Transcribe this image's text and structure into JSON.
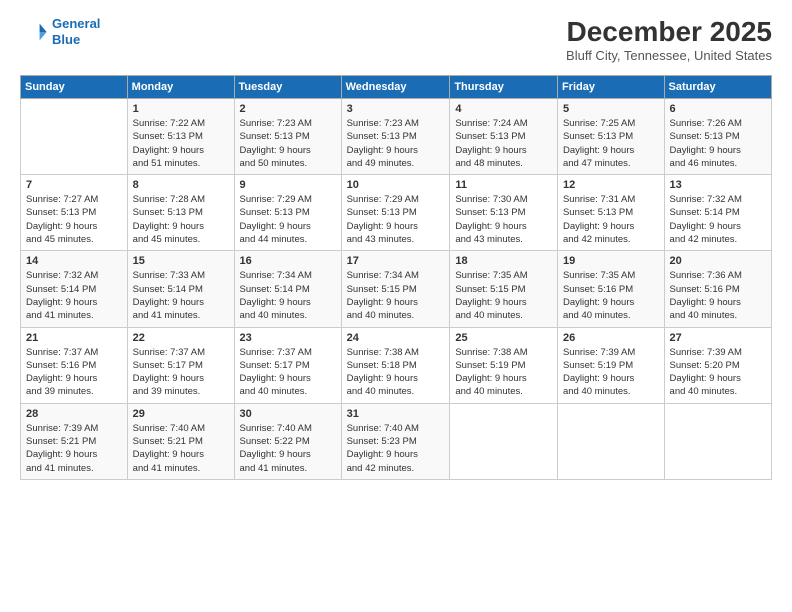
{
  "logo": {
    "line1": "General",
    "line2": "Blue"
  },
  "title": "December 2025",
  "location": "Bluff City, Tennessee, United States",
  "weekdays": [
    "Sunday",
    "Monday",
    "Tuesday",
    "Wednesday",
    "Thursday",
    "Friday",
    "Saturday"
  ],
  "weeks": [
    [
      {
        "day": "",
        "info": ""
      },
      {
        "day": "1",
        "info": "Sunrise: 7:22 AM\nSunset: 5:13 PM\nDaylight: 9 hours\nand 51 minutes."
      },
      {
        "day": "2",
        "info": "Sunrise: 7:23 AM\nSunset: 5:13 PM\nDaylight: 9 hours\nand 50 minutes."
      },
      {
        "day": "3",
        "info": "Sunrise: 7:23 AM\nSunset: 5:13 PM\nDaylight: 9 hours\nand 49 minutes."
      },
      {
        "day": "4",
        "info": "Sunrise: 7:24 AM\nSunset: 5:13 PM\nDaylight: 9 hours\nand 48 minutes."
      },
      {
        "day": "5",
        "info": "Sunrise: 7:25 AM\nSunset: 5:13 PM\nDaylight: 9 hours\nand 47 minutes."
      },
      {
        "day": "6",
        "info": "Sunrise: 7:26 AM\nSunset: 5:13 PM\nDaylight: 9 hours\nand 46 minutes."
      }
    ],
    [
      {
        "day": "7",
        "info": "Sunrise: 7:27 AM\nSunset: 5:13 PM\nDaylight: 9 hours\nand 45 minutes."
      },
      {
        "day": "8",
        "info": "Sunrise: 7:28 AM\nSunset: 5:13 PM\nDaylight: 9 hours\nand 45 minutes."
      },
      {
        "day": "9",
        "info": "Sunrise: 7:29 AM\nSunset: 5:13 PM\nDaylight: 9 hours\nand 44 minutes."
      },
      {
        "day": "10",
        "info": "Sunrise: 7:29 AM\nSunset: 5:13 PM\nDaylight: 9 hours\nand 43 minutes."
      },
      {
        "day": "11",
        "info": "Sunrise: 7:30 AM\nSunset: 5:13 PM\nDaylight: 9 hours\nand 43 minutes."
      },
      {
        "day": "12",
        "info": "Sunrise: 7:31 AM\nSunset: 5:13 PM\nDaylight: 9 hours\nand 42 minutes."
      },
      {
        "day": "13",
        "info": "Sunrise: 7:32 AM\nSunset: 5:14 PM\nDaylight: 9 hours\nand 42 minutes."
      }
    ],
    [
      {
        "day": "14",
        "info": "Sunrise: 7:32 AM\nSunset: 5:14 PM\nDaylight: 9 hours\nand 41 minutes."
      },
      {
        "day": "15",
        "info": "Sunrise: 7:33 AM\nSunset: 5:14 PM\nDaylight: 9 hours\nand 41 minutes."
      },
      {
        "day": "16",
        "info": "Sunrise: 7:34 AM\nSunset: 5:14 PM\nDaylight: 9 hours\nand 40 minutes."
      },
      {
        "day": "17",
        "info": "Sunrise: 7:34 AM\nSunset: 5:15 PM\nDaylight: 9 hours\nand 40 minutes."
      },
      {
        "day": "18",
        "info": "Sunrise: 7:35 AM\nSunset: 5:15 PM\nDaylight: 9 hours\nand 40 minutes."
      },
      {
        "day": "19",
        "info": "Sunrise: 7:35 AM\nSunset: 5:16 PM\nDaylight: 9 hours\nand 40 minutes."
      },
      {
        "day": "20",
        "info": "Sunrise: 7:36 AM\nSunset: 5:16 PM\nDaylight: 9 hours\nand 40 minutes."
      }
    ],
    [
      {
        "day": "21",
        "info": "Sunrise: 7:37 AM\nSunset: 5:16 PM\nDaylight: 9 hours\nand 39 minutes."
      },
      {
        "day": "22",
        "info": "Sunrise: 7:37 AM\nSunset: 5:17 PM\nDaylight: 9 hours\nand 39 minutes."
      },
      {
        "day": "23",
        "info": "Sunrise: 7:37 AM\nSunset: 5:17 PM\nDaylight: 9 hours\nand 40 minutes."
      },
      {
        "day": "24",
        "info": "Sunrise: 7:38 AM\nSunset: 5:18 PM\nDaylight: 9 hours\nand 40 minutes."
      },
      {
        "day": "25",
        "info": "Sunrise: 7:38 AM\nSunset: 5:19 PM\nDaylight: 9 hours\nand 40 minutes."
      },
      {
        "day": "26",
        "info": "Sunrise: 7:39 AM\nSunset: 5:19 PM\nDaylight: 9 hours\nand 40 minutes."
      },
      {
        "day": "27",
        "info": "Sunrise: 7:39 AM\nSunset: 5:20 PM\nDaylight: 9 hours\nand 40 minutes."
      }
    ],
    [
      {
        "day": "28",
        "info": "Sunrise: 7:39 AM\nSunset: 5:21 PM\nDaylight: 9 hours\nand 41 minutes."
      },
      {
        "day": "29",
        "info": "Sunrise: 7:40 AM\nSunset: 5:21 PM\nDaylight: 9 hours\nand 41 minutes."
      },
      {
        "day": "30",
        "info": "Sunrise: 7:40 AM\nSunset: 5:22 PM\nDaylight: 9 hours\nand 41 minutes."
      },
      {
        "day": "31",
        "info": "Sunrise: 7:40 AM\nSunset: 5:23 PM\nDaylight: 9 hours\nand 42 minutes."
      },
      {
        "day": "",
        "info": ""
      },
      {
        "day": "",
        "info": ""
      },
      {
        "day": "",
        "info": ""
      }
    ]
  ]
}
